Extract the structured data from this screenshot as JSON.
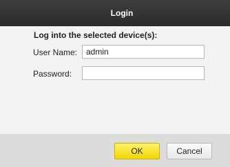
{
  "dialog": {
    "title": "Login"
  },
  "form": {
    "heading": "Log into the selected device(s):",
    "username_label": "User Name:",
    "username_value": "admin",
    "password_label": "Password:",
    "password_value": ""
  },
  "buttons": {
    "ok_label": "OK",
    "cancel_label": "Cancel"
  },
  "colors": {
    "titlebar": "#333333",
    "body": "#f3f3f3",
    "footer": "#dcdcdc",
    "ok_button": "#f7e22a"
  }
}
